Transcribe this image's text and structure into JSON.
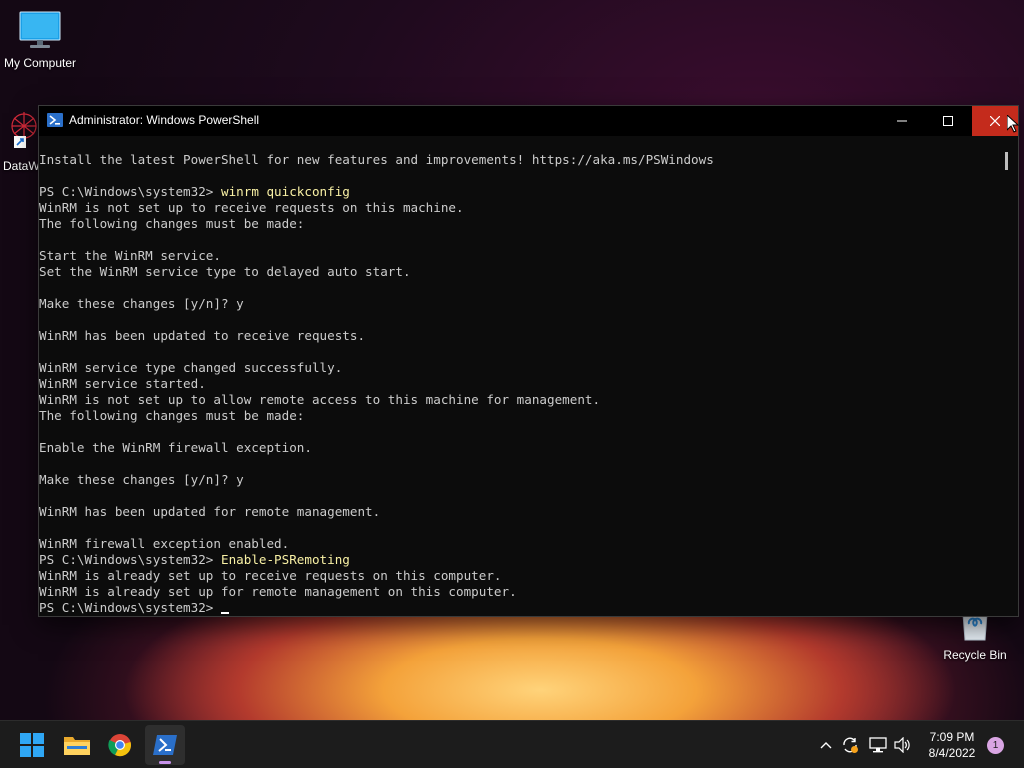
{
  "desktop": {
    "icons": [
      {
        "label": "My Computer"
      },
      {
        "label": "DataW"
      },
      {
        "label": "Recycle Bin"
      }
    ]
  },
  "window": {
    "title": "Administrator: Windows PowerShell",
    "console_lines": [
      {
        "text": "Install the latest PowerShell for new features and improvements! https://aka.ms/PSWindows",
        "cmd": ""
      },
      {
        "text": "",
        "cmd": ""
      },
      {
        "text": "PS C:\\Windows\\system32> ",
        "cmd": "winrm quickconfig"
      },
      {
        "text": "WinRM is not set up to receive requests on this machine.",
        "cmd": ""
      },
      {
        "text": "The following changes must be made:",
        "cmd": ""
      },
      {
        "text": "",
        "cmd": ""
      },
      {
        "text": "Start the WinRM service.",
        "cmd": ""
      },
      {
        "text": "Set the WinRM service type to delayed auto start.",
        "cmd": ""
      },
      {
        "text": "",
        "cmd": ""
      },
      {
        "text": "Make these changes [y/n]? y",
        "cmd": ""
      },
      {
        "text": "",
        "cmd": ""
      },
      {
        "text": "WinRM has been updated to receive requests.",
        "cmd": ""
      },
      {
        "text": "",
        "cmd": ""
      },
      {
        "text": "WinRM service type changed successfully.",
        "cmd": ""
      },
      {
        "text": "WinRM service started.",
        "cmd": ""
      },
      {
        "text": "WinRM is not set up to allow remote access to this machine for management.",
        "cmd": ""
      },
      {
        "text": "The following changes must be made:",
        "cmd": ""
      },
      {
        "text": "",
        "cmd": ""
      },
      {
        "text": "Enable the WinRM firewall exception.",
        "cmd": ""
      },
      {
        "text": "",
        "cmd": ""
      },
      {
        "text": "Make these changes [y/n]? y",
        "cmd": ""
      },
      {
        "text": "",
        "cmd": ""
      },
      {
        "text": "WinRM has been updated for remote management.",
        "cmd": ""
      },
      {
        "text": "",
        "cmd": ""
      },
      {
        "text": "WinRM firewall exception enabled.",
        "cmd": ""
      },
      {
        "text": "PS C:\\Windows\\system32> ",
        "cmd": "Enable-PSRemoting"
      },
      {
        "text": "WinRM is already set up to receive requests on this computer.",
        "cmd": ""
      },
      {
        "text": "WinRM is already set up for remote management on this computer.",
        "cmd": ""
      },
      {
        "text": "PS C:\\Windows\\system32> ",
        "cmd": "",
        "cursor": true
      }
    ]
  },
  "taskbar": {
    "apps": [
      "start-icon",
      "file-explorer-icon",
      "chrome-icon",
      "powershell-icon"
    ],
    "time": "7:09 PM",
    "date": "8/4/2022",
    "notification_count": "1"
  },
  "colors": {
    "console_bg": "#0c0c0c",
    "console_text": "#cccccc",
    "command_text": "#f9f1a5",
    "close_button": "#c42b1c",
    "taskbar_bg": "#1c1c1c"
  }
}
